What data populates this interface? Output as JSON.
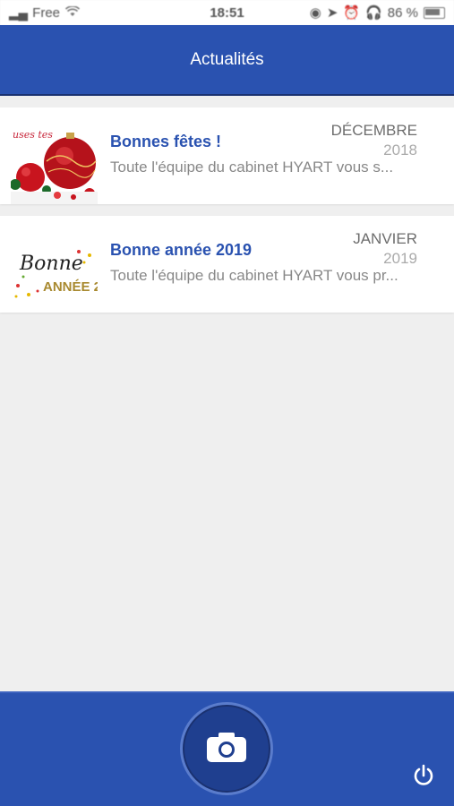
{
  "status_bar": {
    "carrier": "Free",
    "time": "18:51",
    "battery": "86 %"
  },
  "header": {
    "title": "Actualités"
  },
  "news": [
    {
      "title": "Bonnes fêtes !",
      "preview": "Toute l'équipe du cabinet HYART vous s...",
      "month": "DÉCEMBRE",
      "year": "2018",
      "thumb_text": "uses tes"
    },
    {
      "title": "Bonne année 2019",
      "preview": "Toute l'équipe du cabinet HYART vous pr...",
      "month": "JANVIER",
      "year": "2019",
      "thumb_text_1": "Bonne",
      "thumb_text_2": "ANNÉE 2"
    }
  ],
  "bottom_bar": {
    "camera_icon": "camera-icon",
    "power_icon": "power-icon"
  },
  "colors": {
    "primary": "#2a52b0",
    "title_blue": "#2a52b0",
    "background": "#efefef"
  }
}
